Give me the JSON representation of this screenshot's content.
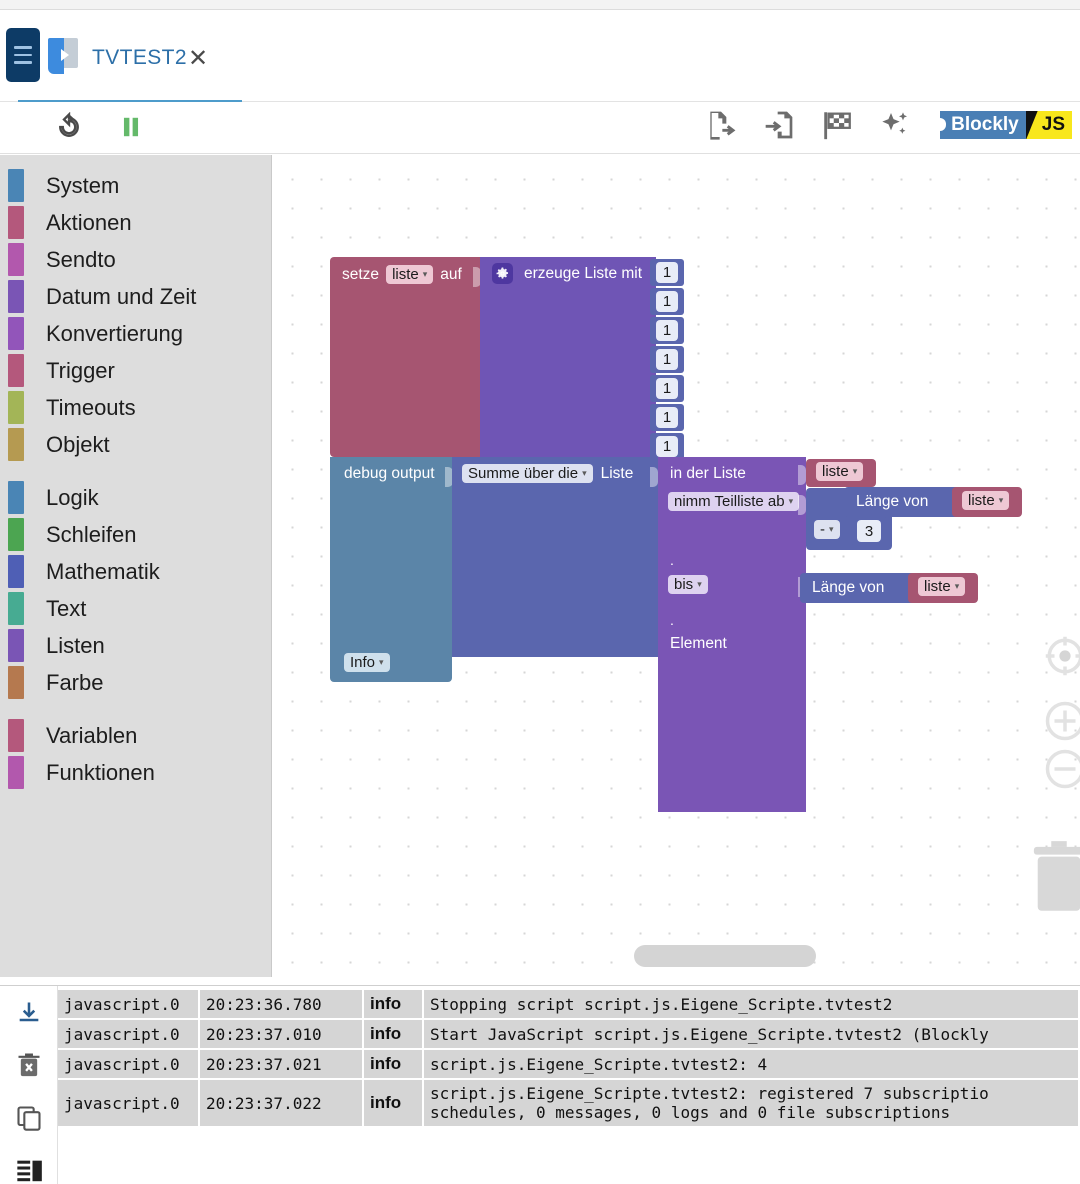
{
  "window": {
    "tab": {
      "title": "TVTEST2",
      "close_icon": "close-icon",
      "menu_icon": "hamburger-icon",
      "script_icon": "script-icon"
    }
  },
  "toolbar": {
    "left": [
      {
        "name": "restart-icon",
        "label": "Neustart"
      },
      {
        "name": "pause-icon",
        "label": "Pause"
      }
    ],
    "right": [
      {
        "name": "export-blocks-icon",
        "label": "Exportieren"
      },
      {
        "name": "import-blocks-icon",
        "label": "Importieren"
      },
      {
        "name": "checkered-flag-icon",
        "label": "Start"
      },
      {
        "name": "sparkles-icon",
        "label": "Aufräumen"
      }
    ],
    "badge": {
      "left_text": "Blockly",
      "right_text": "JS"
    }
  },
  "sidebar": {
    "groups": [
      {
        "items": [
          {
            "label": "System",
            "color": "#4a85b5"
          },
          {
            "label": "Aktionen",
            "color": "#b4587c"
          },
          {
            "label": "Sendto",
            "color": "#b258ad"
          },
          {
            "label": "Datum und Zeit",
            "color": "#7a55b5"
          },
          {
            "label": "Konvertierung",
            "color": "#9255ba"
          },
          {
            "label": "Trigger",
            "color": "#b4587c"
          },
          {
            "label": "Timeouts",
            "color": "#a3b557"
          },
          {
            "label": "Objekt",
            "color": "#b59a51"
          }
        ]
      },
      {
        "items": [
          {
            "label": "Logik",
            "color": "#4a85b5"
          },
          {
            "label": "Schleifen",
            "color": "#4ca551"
          },
          {
            "label": "Mathematik",
            "color": "#4f5fb5"
          },
          {
            "label": "Text",
            "color": "#47ab92"
          },
          {
            "label": "Listen",
            "color": "#7a55b5"
          },
          {
            "label": "Farbe",
            "color": "#b5794f"
          }
        ]
      },
      {
        "items": [
          {
            "label": "Variablen",
            "color": "#b4587c"
          },
          {
            "label": "Funktionen",
            "color": "#b258ad"
          }
        ]
      }
    ]
  },
  "workspace": {
    "blocks": {
      "set_variable": {
        "prefix": "setze",
        "variable": "liste",
        "suffix": "auf",
        "color": "#a65571"
      },
      "create_list": {
        "label": "erzeuge Liste mit",
        "gear_icon": "gear-icon",
        "color": "#6f55b5",
        "items": [
          "1",
          "1",
          "1",
          "1",
          "1",
          "1",
          "1"
        ]
      },
      "debug_output": {
        "label": "debug output",
        "severity": "Info",
        "color": "#5b85a8"
      },
      "list_math": {
        "operation": "Summe über die",
        "label": "Liste",
        "color": "#5a66ae"
      },
      "sublist": {
        "label": "in der Liste",
        "from_mode": "nimm Teilliste ab",
        "to_mode": "bis",
        "suffix": "Element",
        "color": "#7a55b5"
      },
      "var_liste_1": {
        "name": "liste",
        "color": "#a65571"
      },
      "length_of_1": {
        "label": "Länge von",
        "color": "#5a66ae"
      },
      "var_liste_2": {
        "name": "liste",
        "color": "#a65571"
      },
      "arithmetic": {
        "operator": "-",
        "color": "#5a66ae"
      },
      "number_3": {
        "value": "3",
        "color": "#5a66ae"
      },
      "length_of_2": {
        "label": "Länge von",
        "color": "#5a66ae"
      },
      "var_liste_3": {
        "name": "liste",
        "color": "#a65571"
      }
    },
    "controls": [
      {
        "name": "center-workspace-icon"
      },
      {
        "name": "zoom-in-icon"
      },
      {
        "name": "zoom-out-icon"
      },
      {
        "name": "trash-icon"
      }
    ]
  },
  "log": {
    "tools": [
      {
        "name": "download-log-icon"
      },
      {
        "name": "clear-log-icon"
      },
      {
        "name": "copy-log-icon"
      },
      {
        "name": "log-layout-icon"
      }
    ],
    "rows": [
      {
        "source": "javascript.0",
        "timestamp": "20:23:36.780",
        "severity": "info",
        "message": "Stopping script script.js.Eigene_Scripte.tvtest2"
      },
      {
        "source": "javascript.0",
        "timestamp": "20:23:37.010",
        "severity": "info",
        "message": "Start JavaScript script.js.Eigene_Scripte.tvtest2 (Blockly"
      },
      {
        "source": "javascript.0",
        "timestamp": "20:23:37.021",
        "severity": "info",
        "message": "script.js.Eigene_Scripte.tvtest2: 4"
      },
      {
        "source": "javascript.0",
        "timestamp": "20:23:37.022",
        "severity": "info",
        "message": "script.js.Eigene_Scripte.tvtest2: registered 7 subscriptio\nschedules, 0 messages, 0 logs and 0 file subscriptions"
      }
    ]
  }
}
